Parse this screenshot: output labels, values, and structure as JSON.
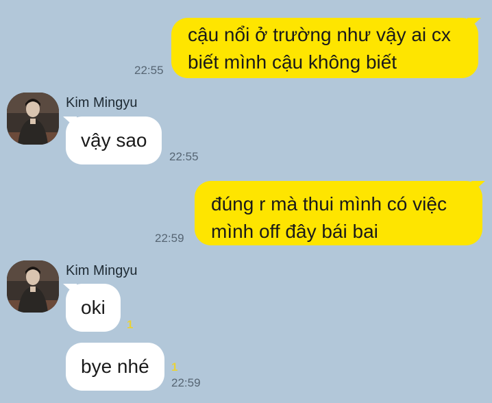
{
  "messages": [
    {
      "side": "out",
      "lines": [
        "cậu nổi ở trường như vậy ai cx",
        "biết mình cậu không biết"
      ],
      "time": "22:55"
    },
    {
      "side": "in",
      "sender": "Kim Mingyu",
      "text": "vậy sao",
      "time": "22:55"
    },
    {
      "side": "out",
      "lines": [
        "đúng r mà thui mình có việc",
        "mình off đây bái bai"
      ],
      "time": "22:59"
    },
    {
      "side": "in",
      "sender": "Kim Mingyu",
      "text": "oki",
      "unread": "1"
    },
    {
      "side": "in",
      "text": "bye nhé",
      "unread": "1",
      "time": "22:59"
    }
  ],
  "colors": {
    "background": "#b2c7d9",
    "outgoing_bubble": "#fee500",
    "incoming_bubble": "#ffffff",
    "unread_count": "#e8d23a"
  },
  "icons": {
    "avatar": "profile-photo"
  }
}
